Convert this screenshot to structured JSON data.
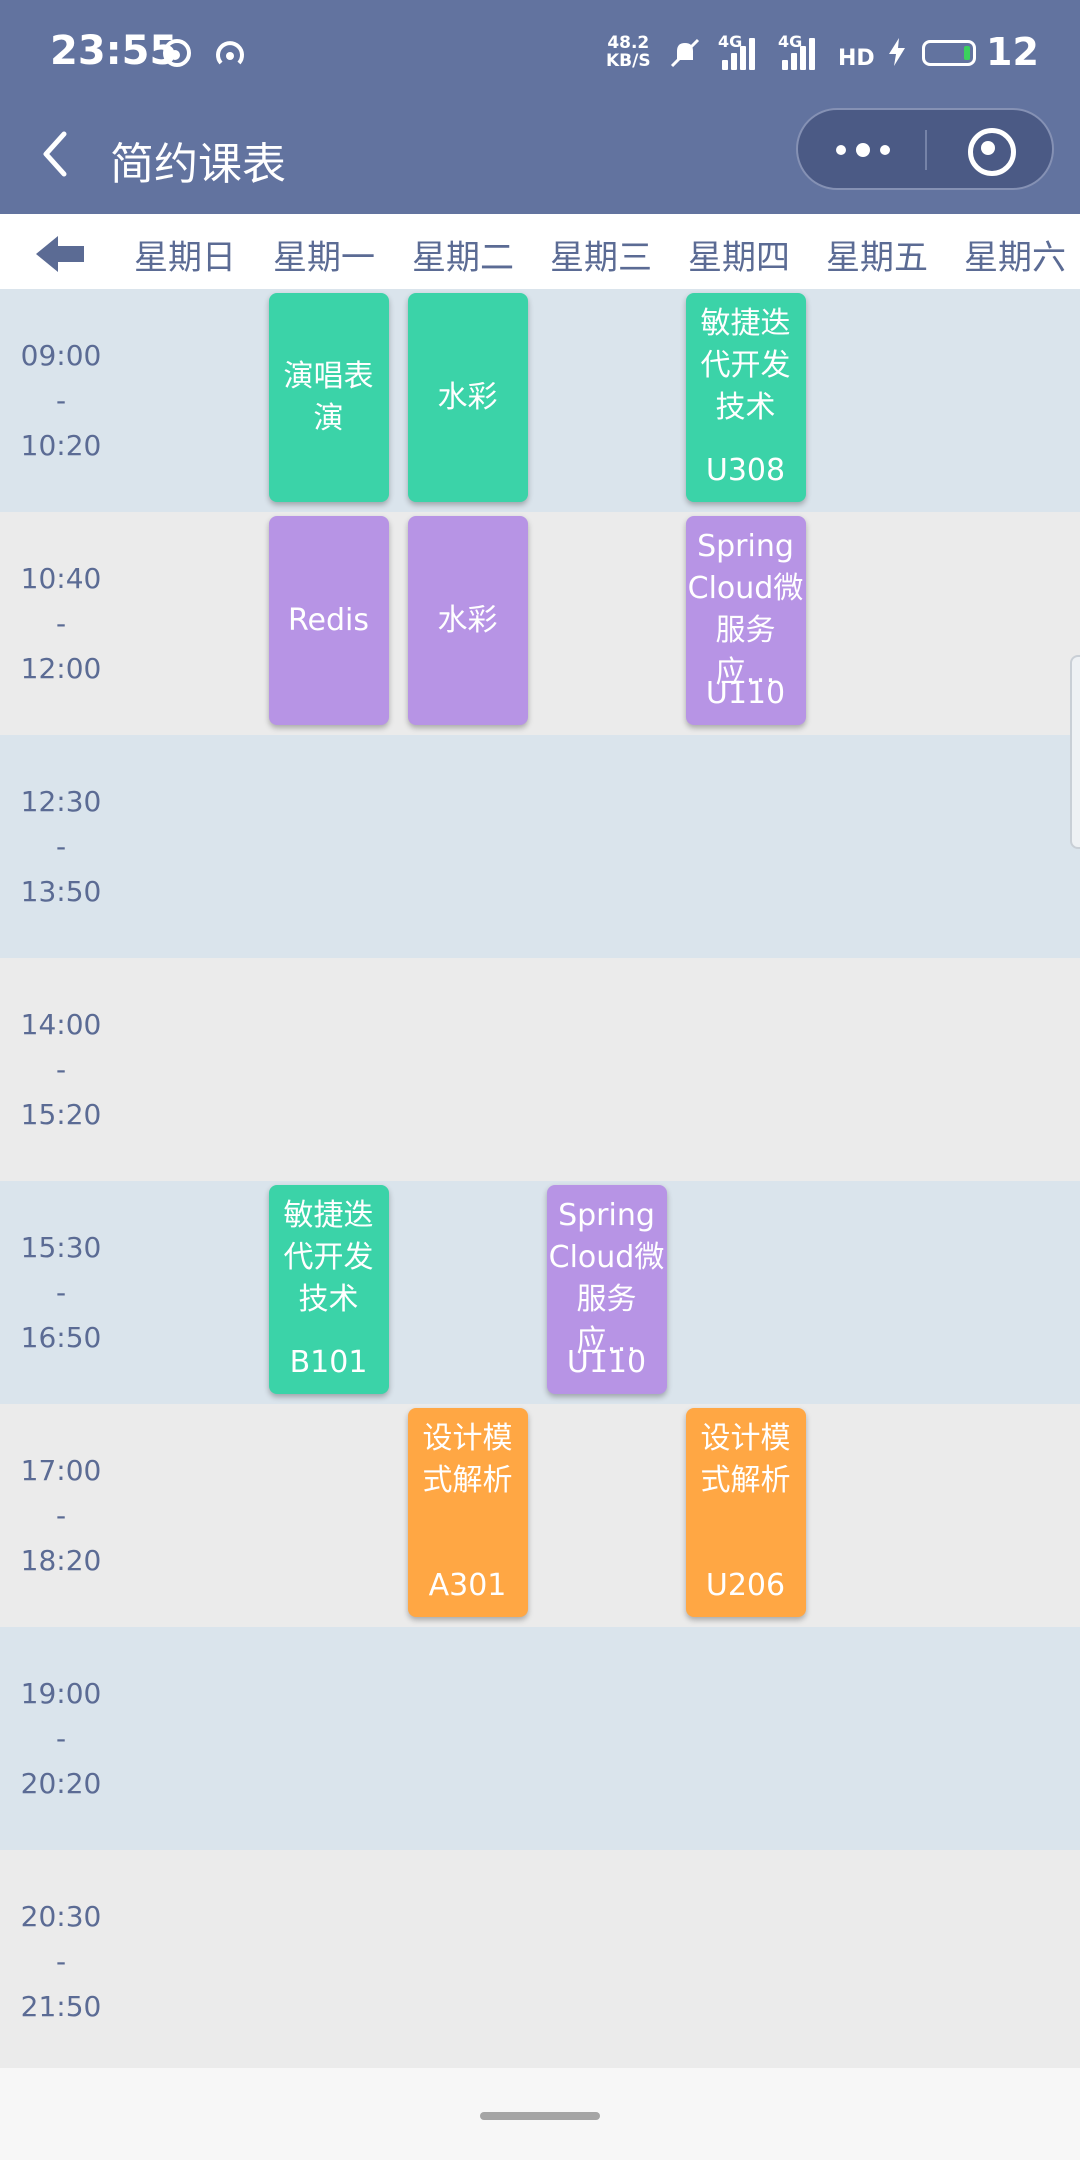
{
  "status_bar": {
    "time": "23:55",
    "net_speed_value": "48.2",
    "net_speed_unit": "KB/S",
    "signal_1": "4G",
    "signal_2": "4G",
    "hd": "HD",
    "battery_text": "12",
    "icons": [
      "weibo-icon",
      "hotspot-icon",
      "mute-icon",
      "signal-icon",
      "signal-icon",
      "hd-icon",
      "charging-icon",
      "battery-icon"
    ]
  },
  "navbar": {
    "title": "简约课表",
    "back_icon": "chevron-left-icon",
    "menu_icon": "more-dots-icon",
    "close_icon": "target-icon"
  },
  "days": [
    "星期日",
    "星期一",
    "星期二",
    "星期三",
    "星期四",
    "星期五",
    "星期六"
  ],
  "prev_week_icon": "arrow-left-icon",
  "periods": [
    {
      "start": "09:00",
      "sep": "-",
      "end": "10:20"
    },
    {
      "start": "10:40",
      "sep": "-",
      "end": "12:00"
    },
    {
      "start": "12:30",
      "sep": "-",
      "end": "13:50"
    },
    {
      "start": "14:00",
      "sep": "-",
      "end": "15:20"
    },
    {
      "start": "15:30",
      "sep": "-",
      "end": "16:50"
    },
    {
      "start": "17:00",
      "sep": "-",
      "end": "18:20"
    },
    {
      "start": "19:00",
      "sep": "-",
      "end": "20:20"
    },
    {
      "start": "20:30",
      "sep": "-",
      "end": "21:50"
    }
  ],
  "courses": [
    {
      "name": "演唱表演",
      "room": "",
      "day": 1,
      "period": 0,
      "color": "green"
    },
    {
      "name": "水彩",
      "room": "",
      "day": 2,
      "period": 0,
      "color": "green"
    },
    {
      "name": "敏捷迭代开发技术",
      "room": "U308",
      "day": 4,
      "period": 0,
      "color": "green"
    },
    {
      "name": "Redis",
      "room": "",
      "day": 1,
      "period": 1,
      "color": "purple"
    },
    {
      "name": "水彩",
      "room": "",
      "day": 2,
      "period": 1,
      "color": "purple"
    },
    {
      "name": "Spring Cloud微服务应…",
      "room": "U110",
      "day": 4,
      "period": 1,
      "color": "purple"
    },
    {
      "name": "敏捷迭代开发技术",
      "room": "B101",
      "day": 1,
      "period": 4,
      "color": "green"
    },
    {
      "name": "Spring Cloud微服务应…",
      "room": "U110",
      "day": 3,
      "period": 4,
      "color": "purple"
    },
    {
      "name": "设计模式解析",
      "room": "A301",
      "day": 2,
      "period": 5,
      "color": "orange"
    },
    {
      "name": "设计模式解析",
      "room": "U206",
      "day": 4,
      "period": 5,
      "color": "orange"
    }
  ],
  "colors": {
    "header": "#62739f",
    "text_blue": "#5b6b94",
    "row_blue": "#dae4ec",
    "row_gray": "#ebebeb",
    "green": "#3bd3a8",
    "purple": "#b794e5",
    "orange": "#ffa744"
  }
}
